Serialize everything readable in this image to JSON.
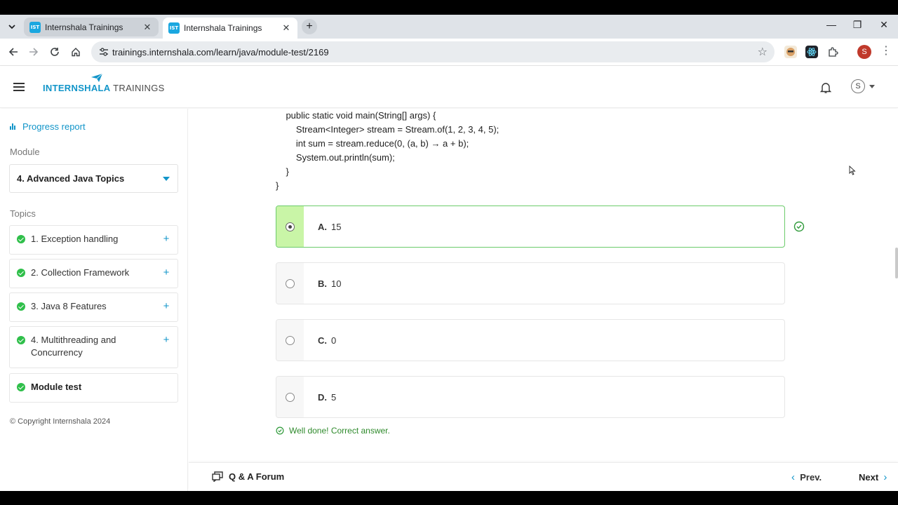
{
  "browser": {
    "tabs": [
      {
        "favicon": "IST",
        "title": "Internshala Trainings",
        "close": "✕"
      },
      {
        "favicon": "IST",
        "title": "Internshala Trainings",
        "close": "✕"
      }
    ],
    "new_tab": "+",
    "url": "trainings.internshala.com/learn/java/module-test/2169",
    "profile_initial": "S",
    "window_controls": {
      "minimize": "—",
      "maximize": "❐",
      "close": "✕"
    }
  },
  "header": {
    "logo_primary": "INTERNSHALA",
    "logo_secondary": " TRAININGS",
    "user_initial": "S"
  },
  "sidebar": {
    "progress_label": "Progress report",
    "module_label": "Module",
    "module_selected": "4. Advanced Java Topics",
    "topics_label": "Topics",
    "topics": [
      {
        "label": "1. Exception handling",
        "expand": "+"
      },
      {
        "label": "2. Collection Framework",
        "expand": "+"
      },
      {
        "label": "3. Java 8 Features",
        "expand": "+"
      },
      {
        "label": "4. Multithreading and Concurrency",
        "expand": "+"
      },
      {
        "label": "Module test",
        "expand": ""
      }
    ],
    "copyright": "© Copyright Internshala 2024"
  },
  "question": {
    "code_lines": [
      "    public static void main(String[] args) {",
      "        Stream<Integer> stream = Stream.of(1, 2, 3, 4, 5);",
      "        int sum = stream.reduce(0, (a, b) → a + b);",
      "        System.out.println(sum);",
      "    }",
      "}"
    ],
    "options": [
      {
        "letter": "A.",
        "text": "15",
        "selected": true
      },
      {
        "letter": "B.",
        "text": "10",
        "selected": false
      },
      {
        "letter": "C.",
        "text": "0",
        "selected": false
      },
      {
        "letter": "D.",
        "text": "5",
        "selected": false
      }
    ],
    "feedback": "Well done! Correct answer."
  },
  "footer": {
    "forum_label": "Q & A Forum",
    "prev_label": "Prev.",
    "next_label": "Next"
  },
  "colors": {
    "brand_blue": "#1295c9",
    "success_green": "#2fbf4a",
    "selected_bg": "#c9f5a7"
  }
}
